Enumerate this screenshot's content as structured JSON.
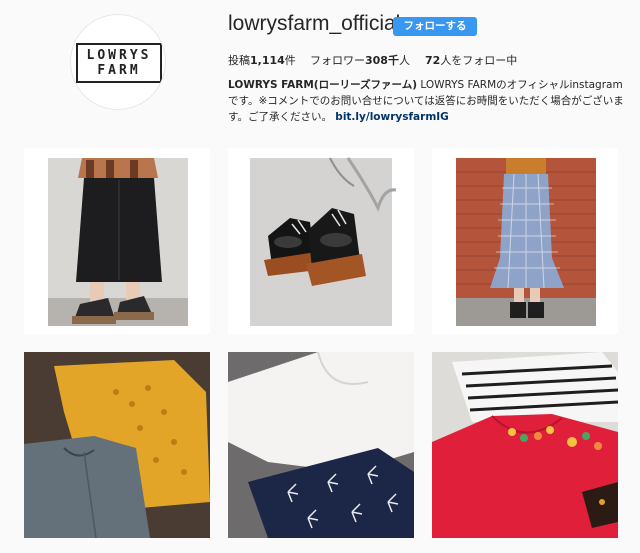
{
  "profile": {
    "avatar": {
      "logo_top": "LOWRYS",
      "logo_bottom": "FARM"
    },
    "username": "lowrysfarm_official",
    "follow_label": "フォローする"
  },
  "stats": {
    "posts_label": "投稿",
    "posts_value": "1,114",
    "posts_unit": "件",
    "followers_label": "フォロワー",
    "followers_value": "308千",
    "followers_unit": "人",
    "following_value": "72",
    "following_label": "人をフォロー中"
  },
  "bio": {
    "name": "LOWRYS FARM(ローリーズファーム)",
    "text": " LOWRYS FARMのオフィシャルinstagramです。※コメントでのお問い合せについては返答にお時間をいただく場合がございます。ご了承ください。",
    "link": "bit.ly/lowrysfarmIG"
  },
  "colors": {
    "accent": "#3897f0",
    "link": "#003569",
    "background": "#fafafa"
  }
}
